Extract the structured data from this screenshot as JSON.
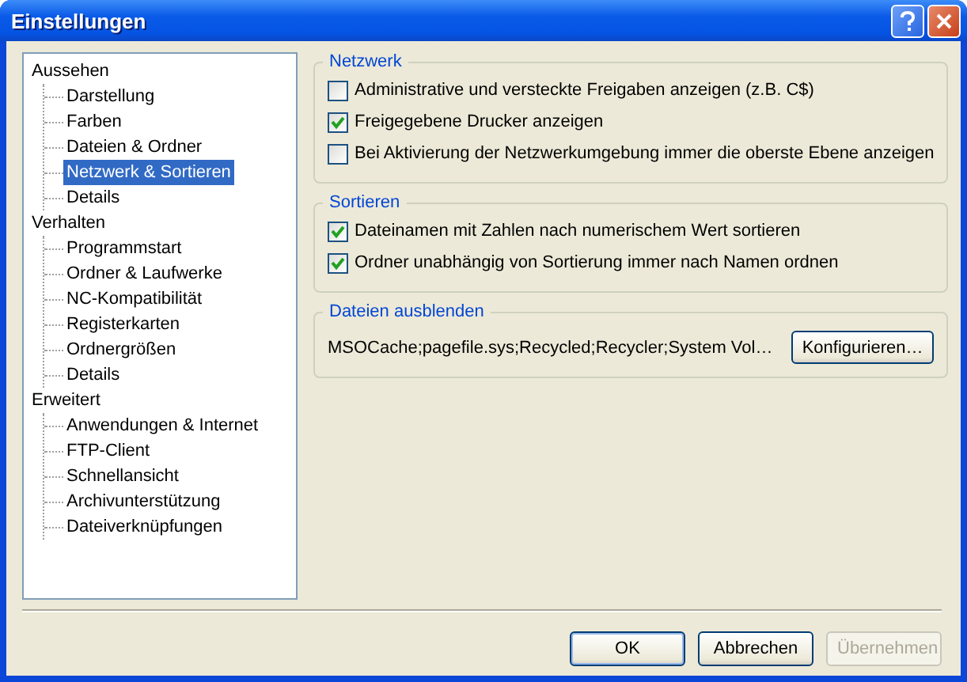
{
  "window": {
    "title": "Einstellungen"
  },
  "tree": [
    {
      "label": "Aussehen",
      "selected": false,
      "children": [
        {
          "label": "Darstellung",
          "selected": false
        },
        {
          "label": "Farben",
          "selected": false
        },
        {
          "label": "Dateien & Ordner",
          "selected": false
        },
        {
          "label": "Netzwerk & Sortieren",
          "selected": true
        },
        {
          "label": "Details",
          "selected": false
        }
      ]
    },
    {
      "label": "Verhalten",
      "selected": false,
      "children": [
        {
          "label": "Programmstart",
          "selected": false
        },
        {
          "label": "Ordner & Laufwerke",
          "selected": false
        },
        {
          "label": "NC-Kompatibilität",
          "selected": false
        },
        {
          "label": "Registerkarten",
          "selected": false
        },
        {
          "label": "Ordnergrößen",
          "selected": false
        },
        {
          "label": "Details",
          "selected": false
        }
      ]
    },
    {
      "label": "Erweitert",
      "selected": false,
      "children": [
        {
          "label": "Anwendungen & Internet",
          "selected": false
        },
        {
          "label": "FTP-Client",
          "selected": false
        },
        {
          "label": "Schnellansicht",
          "selected": false
        },
        {
          "label": "Archivunterstützung",
          "selected": false
        },
        {
          "label": "Dateiverknüpfungen",
          "selected": false
        }
      ]
    }
  ],
  "groups": [
    {
      "title": "Netzwerk",
      "kind": "checkboxes",
      "options": [
        {
          "label": "Administrative und versteckte Freigaben anzeigen (z.B. C$)",
          "checked": false
        },
        {
          "label": "Freigegebene Drucker anzeigen",
          "checked": true
        },
        {
          "label": "Bei Aktivierung der Netzwerkumgebung immer die oberste Ebene anzeigen",
          "checked": false
        }
      ]
    },
    {
      "title": "Sortieren",
      "kind": "checkboxes",
      "options": [
        {
          "label": "Dateinamen mit Zahlen nach numerischem Wert sortieren",
          "checked": true
        },
        {
          "label": "Ordner unabhängig von Sortierung immer nach Namen ordnen",
          "checked": true
        }
      ]
    },
    {
      "title": "Dateien ausblenden",
      "kind": "list",
      "value": "MSOCache;pagefile.sys;Recycled;Recycler;System Vol…",
      "button": "Konfigurieren…"
    }
  ],
  "buttons": [
    {
      "label": "OK",
      "disabled": false,
      "default": true
    },
    {
      "label": "Abbrechen",
      "disabled": false,
      "default": false
    },
    {
      "label": "Übernehmen",
      "disabled": true,
      "default": false
    }
  ]
}
